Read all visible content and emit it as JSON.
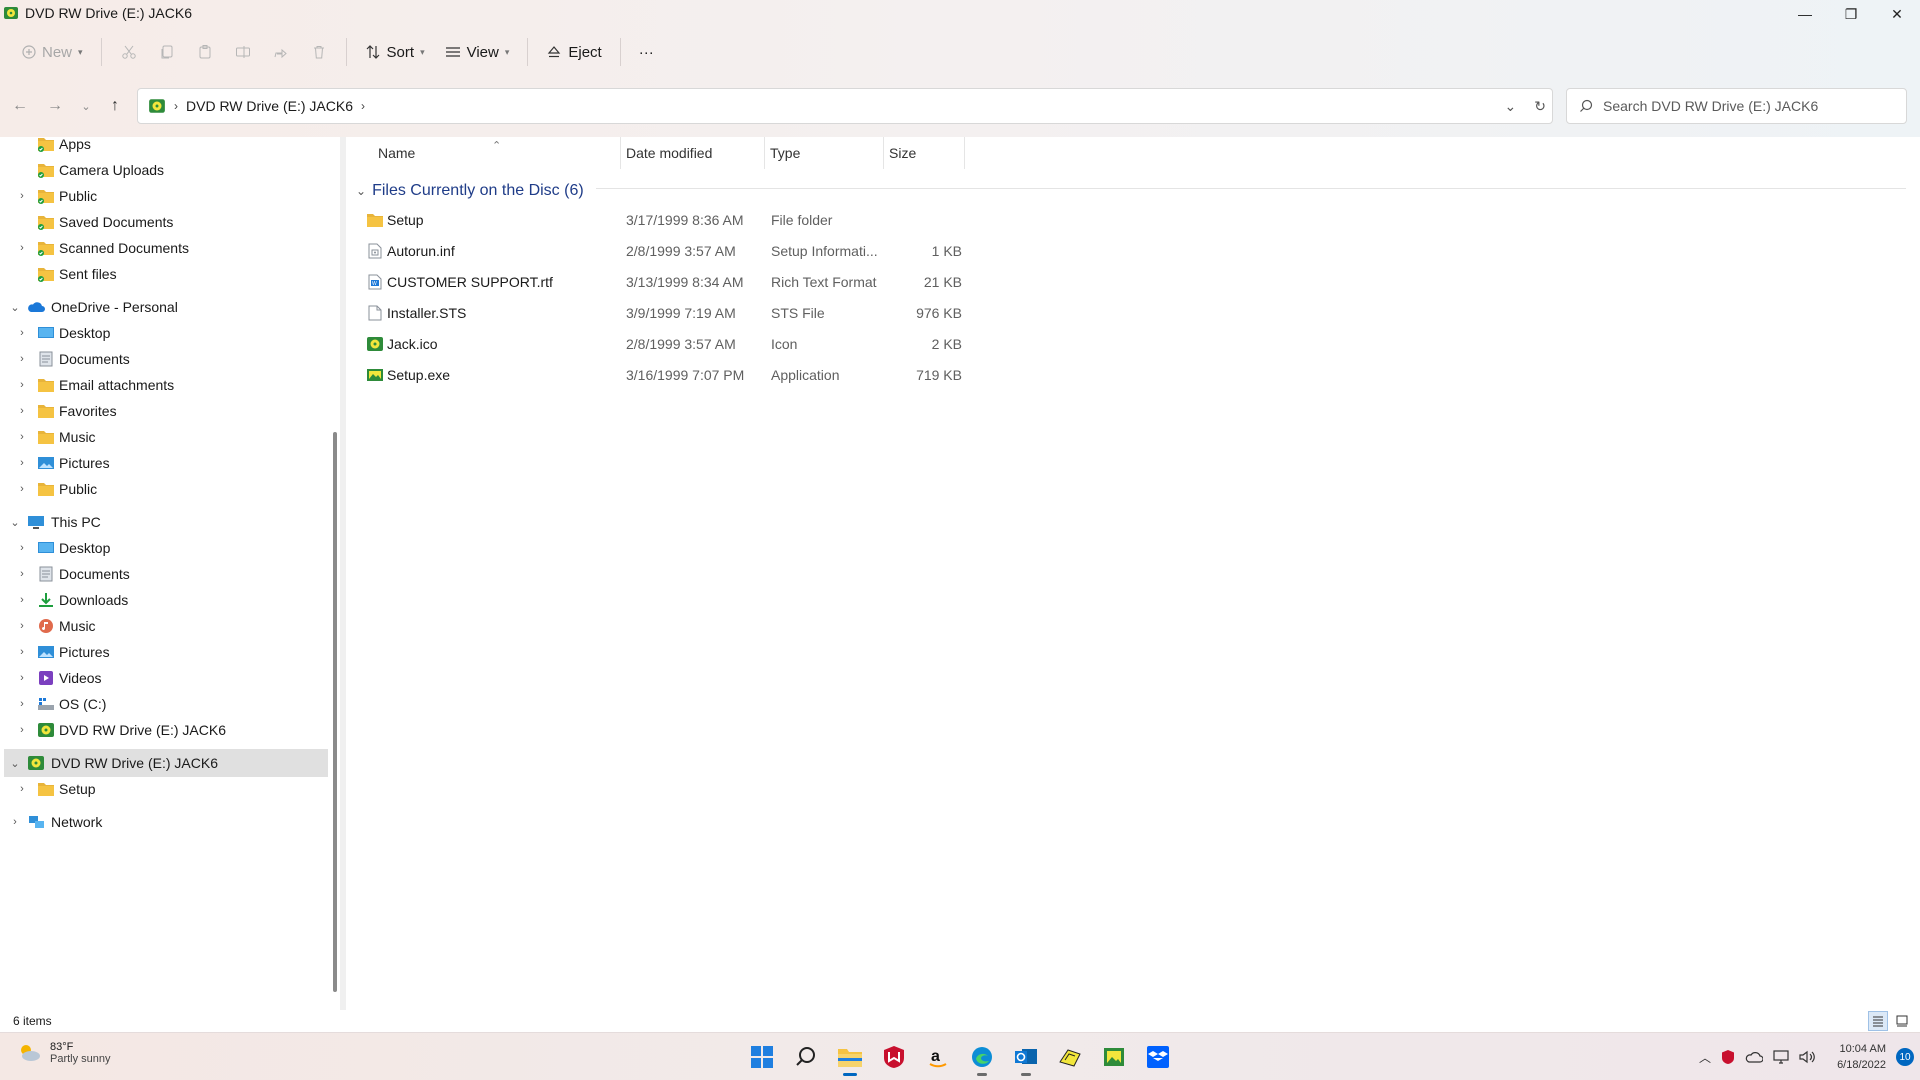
{
  "window": {
    "title": "DVD RW Drive (E:) JACK6",
    "minimize_glyph": "—",
    "maximize_glyph": "❐",
    "close_glyph": "✕"
  },
  "toolbar": {
    "new_label": "New",
    "sort_label": "Sort",
    "view_label": "View",
    "eject_label": "Eject",
    "more_label": "···"
  },
  "address": {
    "crumb": "DVD RW Drive (E:) JACK6",
    "sep1": "›",
    "sep2": "›"
  },
  "search": {
    "placeholder": "Search DVD RW Drive (E:) JACK6"
  },
  "nav_tree": [
    {
      "label": "Apps",
      "icon": "sync-folder-icon",
      "depth": 2,
      "chevron": ""
    },
    {
      "label": "Camera Uploads",
      "icon": "sync-folder-icon",
      "depth": 2,
      "chevron": ""
    },
    {
      "label": "Public",
      "icon": "sync-folder-icon",
      "depth": 2,
      "chevron": "›"
    },
    {
      "label": "Saved Documents",
      "icon": "sync-folder-icon",
      "depth": 2,
      "chevron": ""
    },
    {
      "label": "Scanned Documents",
      "icon": "sync-folder-icon",
      "depth": 2,
      "chevron": "›"
    },
    {
      "label": "Sent files",
      "icon": "sync-folder-icon",
      "depth": 2,
      "chevron": ""
    },
    {
      "label": "OneDrive - Personal",
      "icon": "onedrive-cloud-icon",
      "depth": 1,
      "chevron": "⌄"
    },
    {
      "label": "Desktop",
      "icon": "desktop-icon",
      "depth": 2,
      "chevron": "›"
    },
    {
      "label": "Documents",
      "icon": "documents-icon",
      "depth": 2,
      "chevron": "›"
    },
    {
      "label": "Email attachments",
      "icon": "folder-icon",
      "depth": 2,
      "chevron": "›"
    },
    {
      "label": "Favorites",
      "icon": "folder-icon",
      "depth": 2,
      "chevron": "›"
    },
    {
      "label": "Music",
      "icon": "folder-icon",
      "depth": 2,
      "chevron": "›"
    },
    {
      "label": "Pictures",
      "icon": "pictures-icon",
      "depth": 2,
      "chevron": "›"
    },
    {
      "label": "Public",
      "icon": "folder-icon",
      "depth": 2,
      "chevron": "›"
    },
    {
      "label": "This PC",
      "icon": "this-pc-icon",
      "depth": 1,
      "chevron": "⌄"
    },
    {
      "label": "Desktop",
      "icon": "desktop-icon",
      "depth": 2,
      "chevron": "›"
    },
    {
      "label": "Documents",
      "icon": "documents-icon",
      "depth": 2,
      "chevron": "›"
    },
    {
      "label": "Downloads",
      "icon": "downloads-icon",
      "depth": 2,
      "chevron": "›"
    },
    {
      "label": "Music",
      "icon": "music-icon",
      "depth": 2,
      "chevron": "›"
    },
    {
      "label": "Pictures",
      "icon": "pictures-icon",
      "depth": 2,
      "chevron": "›"
    },
    {
      "label": "Videos",
      "icon": "videos-icon",
      "depth": 2,
      "chevron": "›"
    },
    {
      "label": "OS (C:)",
      "icon": "drive-icon",
      "depth": 2,
      "chevron": "›"
    },
    {
      "label": "DVD RW Drive (E:) JACK6",
      "icon": "dvd-drive-icon",
      "depth": 2,
      "chevron": "›"
    },
    {
      "label": "DVD RW Drive (E:) JACK6",
      "icon": "dvd-drive-icon",
      "depth": 1,
      "chevron": "⌄",
      "selected": true
    },
    {
      "label": "Setup",
      "icon": "folder-icon",
      "depth": 2,
      "chevron": "›"
    },
    {
      "label": "Network",
      "icon": "network-icon",
      "depth": 1,
      "chevron": "›"
    }
  ],
  "columns": {
    "name": "Name",
    "date": "Date modified",
    "type": "Type",
    "size": "Size",
    "sort_glyph": "⌃"
  },
  "group": {
    "label": "Files Currently on the Disc (6)",
    "toggle": "⌄"
  },
  "files": [
    {
      "name": "Setup",
      "date": "3/17/1999 8:36 AM",
      "type": "File folder",
      "size": "",
      "icon": "folder-icon"
    },
    {
      "name": "Autorun.inf",
      "date": "2/8/1999 3:57 AM",
      "type": "Setup Informati...",
      "size": "1 KB",
      "icon": "setup-info-file-icon"
    },
    {
      "name": "CUSTOMER SUPPORT.rtf",
      "date": "3/13/1999 8:34 AM",
      "type": "Rich Text Format",
      "size": "21 KB",
      "icon": "rtf-file-icon"
    },
    {
      "name": "Installer.STS",
      "date": "3/9/1999 7:19 AM",
      "type": "STS File",
      "size": "976 KB",
      "icon": "generic-file-icon"
    },
    {
      "name": "Jack.ico",
      "date": "2/8/1999 3:57 AM",
      "type": "Icon",
      "size": "2 KB",
      "icon": "jack-icon-file-icon"
    },
    {
      "name": "Setup.exe",
      "date": "3/16/1999 7:07 PM",
      "type": "Application",
      "size": "719 KB",
      "icon": "application-icon"
    }
  ],
  "status": {
    "count": "6 items"
  },
  "taskbar": {
    "weather_temp": "83°F",
    "weather_cond": "Partly sunny",
    "time": "10:04 AM",
    "date": "6/18/2022",
    "notifications": "10",
    "apps": [
      "start-icon",
      "search-icon",
      "file-explorer-icon",
      "mcafee-icon",
      "amazon-icon",
      "edge-icon",
      "outlook-icon",
      "jack-app-icon",
      "image-app-icon",
      "dropbox-icon"
    ]
  },
  "colors": {
    "accent": "#0067c0",
    "group_text": "#1f3c88",
    "folder": "#f5c342",
    "selected_bg": "#e0e0e0"
  }
}
